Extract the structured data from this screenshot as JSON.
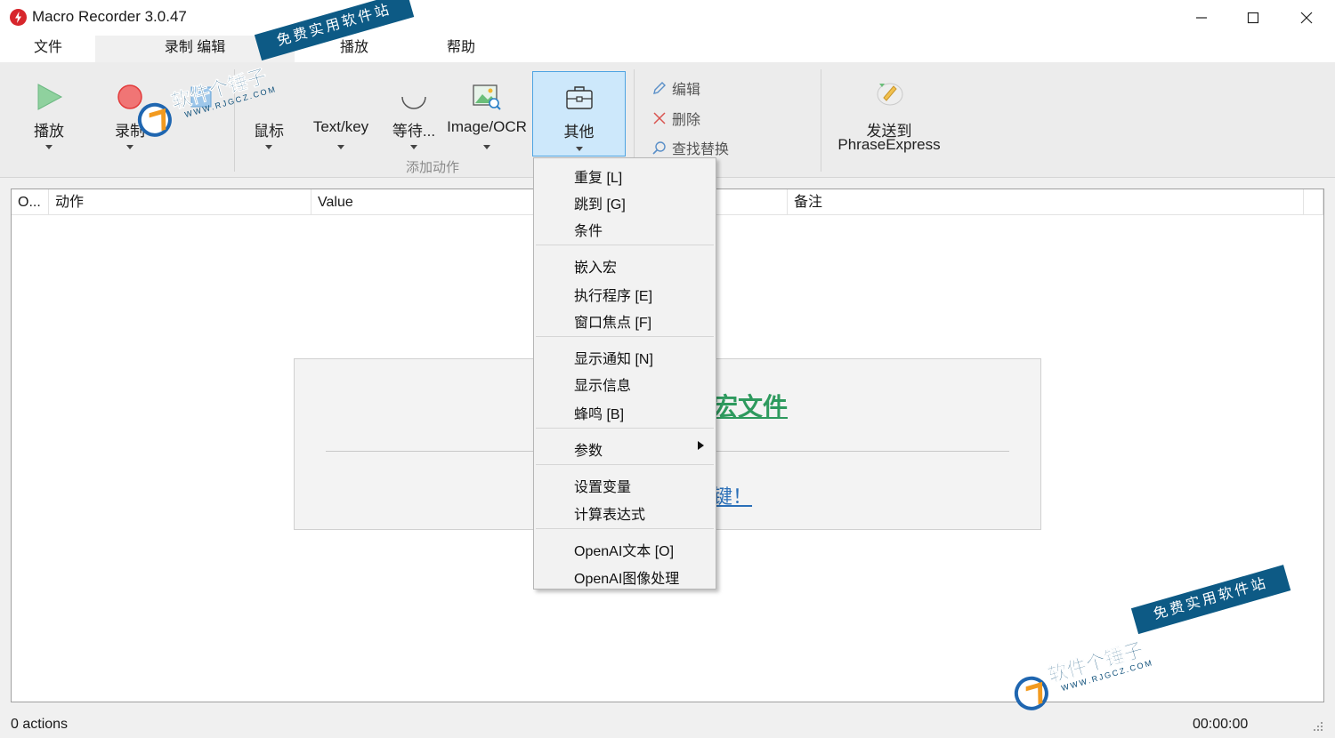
{
  "window": {
    "title": "Macro Recorder 3.0.47",
    "icon": "lightning-icon",
    "controls": [
      "minimize-icon",
      "maximize-icon",
      "close-icon"
    ]
  },
  "tabs": [
    "文件",
    "录制 编辑",
    "播放",
    "帮助"
  ],
  "active_tab": "录制 编辑",
  "ribbon": {
    "play_label": "播放",
    "record_label": "录制",
    "mouse_label": "鼠标",
    "textkey_label": "Text/key",
    "wait_label": "等待...",
    "imageocr_label": "Image/OCR",
    "other_label": "其他",
    "add_action_group": "添加动作",
    "edit_label": "编辑",
    "delete_label": "删除",
    "findreplace_label": "查找替换",
    "send_to_line1": "发送到",
    "send_to_line2": "PhraseExpress"
  },
  "grid": {
    "columns": [
      "O...",
      "动作",
      "Value",
      "备注"
    ]
  },
  "welcome": {
    "title": "宏文件",
    "link": "键！"
  },
  "menu": {
    "items": [
      "重复 [L]",
      "跳到 [G]",
      "条件",
      "嵌入宏",
      "执行程序 [E]",
      "窗口焦点 [F]",
      "显示通知 [N]",
      "显示信息",
      "蜂鸣 [B]",
      "参数",
      "设置变量",
      "计算表达式",
      "OpenAI文本 [O]",
      "OpenAI图像处理"
    ]
  },
  "status": {
    "actions": "0 actions",
    "time": "00:00:00"
  },
  "watermark": {
    "brand": "软件个锤子",
    "slogan": "免费实用软件站",
    "url": "WWW.RJGCZ.COM"
  },
  "colors": {
    "accent": "#4ea4e2",
    "selected_bg": "#cde8fb",
    "record_red": "#e23b3b",
    "play_green": "#8fd19e",
    "link_green": "#2e9a5e",
    "link_blue": "#2a6fb8",
    "watermark_blue": "#0d5a85"
  }
}
